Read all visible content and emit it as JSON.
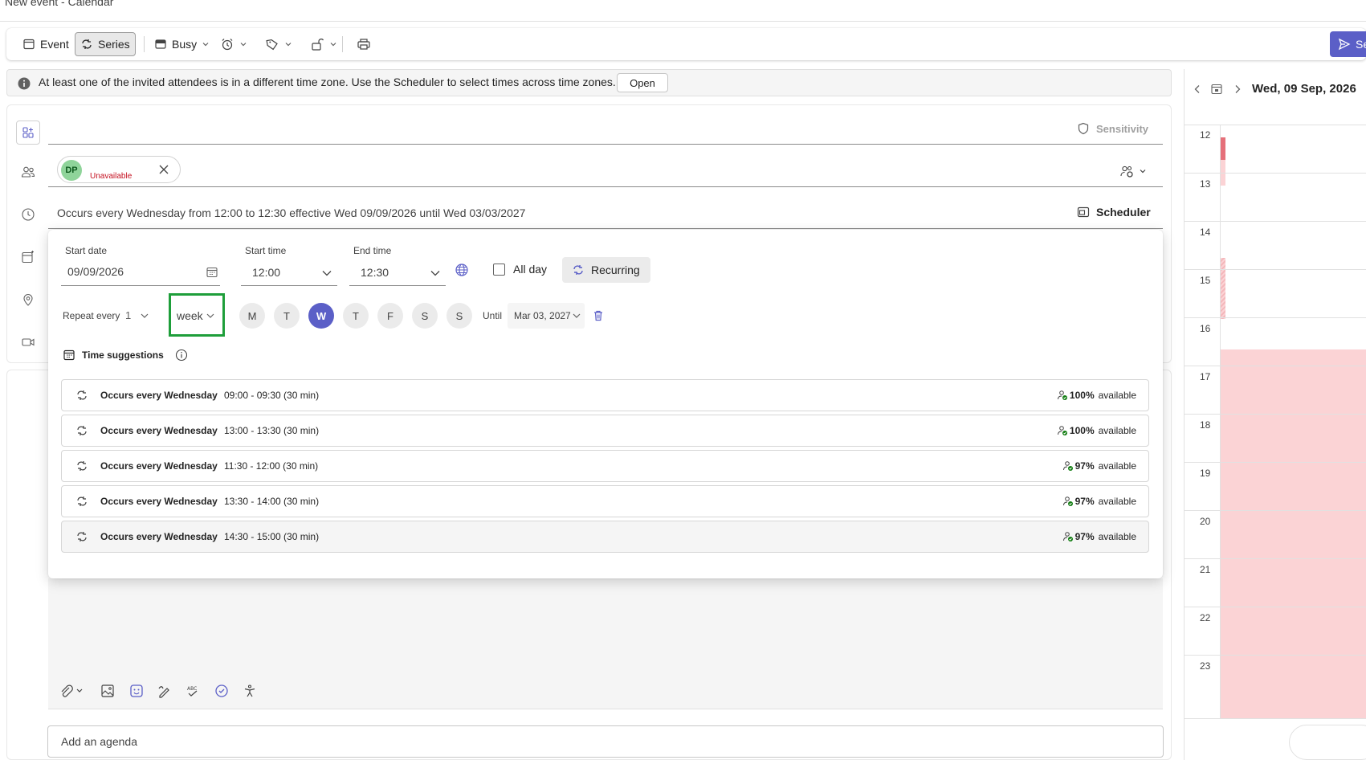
{
  "window": {
    "title": "New event - Calendar"
  },
  "toolbar": {
    "event_label": "Event",
    "series_label": "Series",
    "busy_label": "Busy",
    "send_label": "Se"
  },
  "info_bar": {
    "message": "At least one of the invited attendees is in a different time zone. Use the Scheduler to select times across time zones.",
    "open_label": "Open"
  },
  "form": {
    "sensitivity_label": "Sensitivity",
    "attendee": {
      "initials": "DP",
      "status": "Unavailable"
    },
    "occurs_summary": "Occurs every Wednesday from 12:00 to 12:30 effective Wed 09/09/2026 until Wed 03/03/2027",
    "scheduler_label": "Scheduler"
  },
  "recurrence": {
    "start_date_label": "Start date",
    "start_date": "09/09/2026",
    "start_time_label": "Start time",
    "start_time": "12:00",
    "end_time_label": "End time",
    "end_time": "12:30",
    "all_day_label": "All day",
    "all_day_checked": false,
    "recurring_label": "Recurring",
    "repeat_every_label": "Repeat every",
    "repeat_interval": "1",
    "repeat_unit": "week",
    "days": [
      {
        "label": "M",
        "selected": false
      },
      {
        "label": "T",
        "selected": false
      },
      {
        "label": "W",
        "selected": true
      },
      {
        "label": "T",
        "selected": false
      },
      {
        "label": "F",
        "selected": false
      },
      {
        "label": "S",
        "selected": false
      },
      {
        "label": "S",
        "selected": false
      }
    ],
    "until_label": "Until",
    "until_date": "Mar 03, 2027"
  },
  "time_suggestions": {
    "title": "Time suggestions",
    "items": [
      {
        "title": "Occurs every Wednesday",
        "time": "09:00 - 09:30 (30 min)",
        "availability": "100%",
        "availability_suffix": "available"
      },
      {
        "title": "Occurs every Wednesday",
        "time": "13:00 - 13:30 (30 min)",
        "availability": "100%",
        "availability_suffix": "available"
      },
      {
        "title": "Occurs every Wednesday",
        "time": "11:30 - 12:00 (30 min)",
        "availability": "97%",
        "availability_suffix": "available"
      },
      {
        "title": "Occurs every Wednesday",
        "time": "13:30 - 14:00 (30 min)",
        "availability": "97%",
        "availability_suffix": "available"
      },
      {
        "title": "Occurs every Wednesday",
        "time": "14:30 - 15:00 (30 min)",
        "availability": "97%",
        "availability_suffix": "available"
      }
    ]
  },
  "agenda": {
    "placeholder": "Add an agenda"
  },
  "calendar": {
    "date_label": "Wed, 09 Sep, 2026",
    "hours": [
      "12",
      "13",
      "14",
      "15",
      "16",
      "17",
      "18",
      "19",
      "20",
      "21",
      "22",
      "23"
    ]
  },
  "colors": {
    "accent": "#5b5fc7",
    "busy": "#fbd3d5",
    "unavailable_text": "#c50f1f",
    "highlight_box": "#1e9e3a"
  }
}
